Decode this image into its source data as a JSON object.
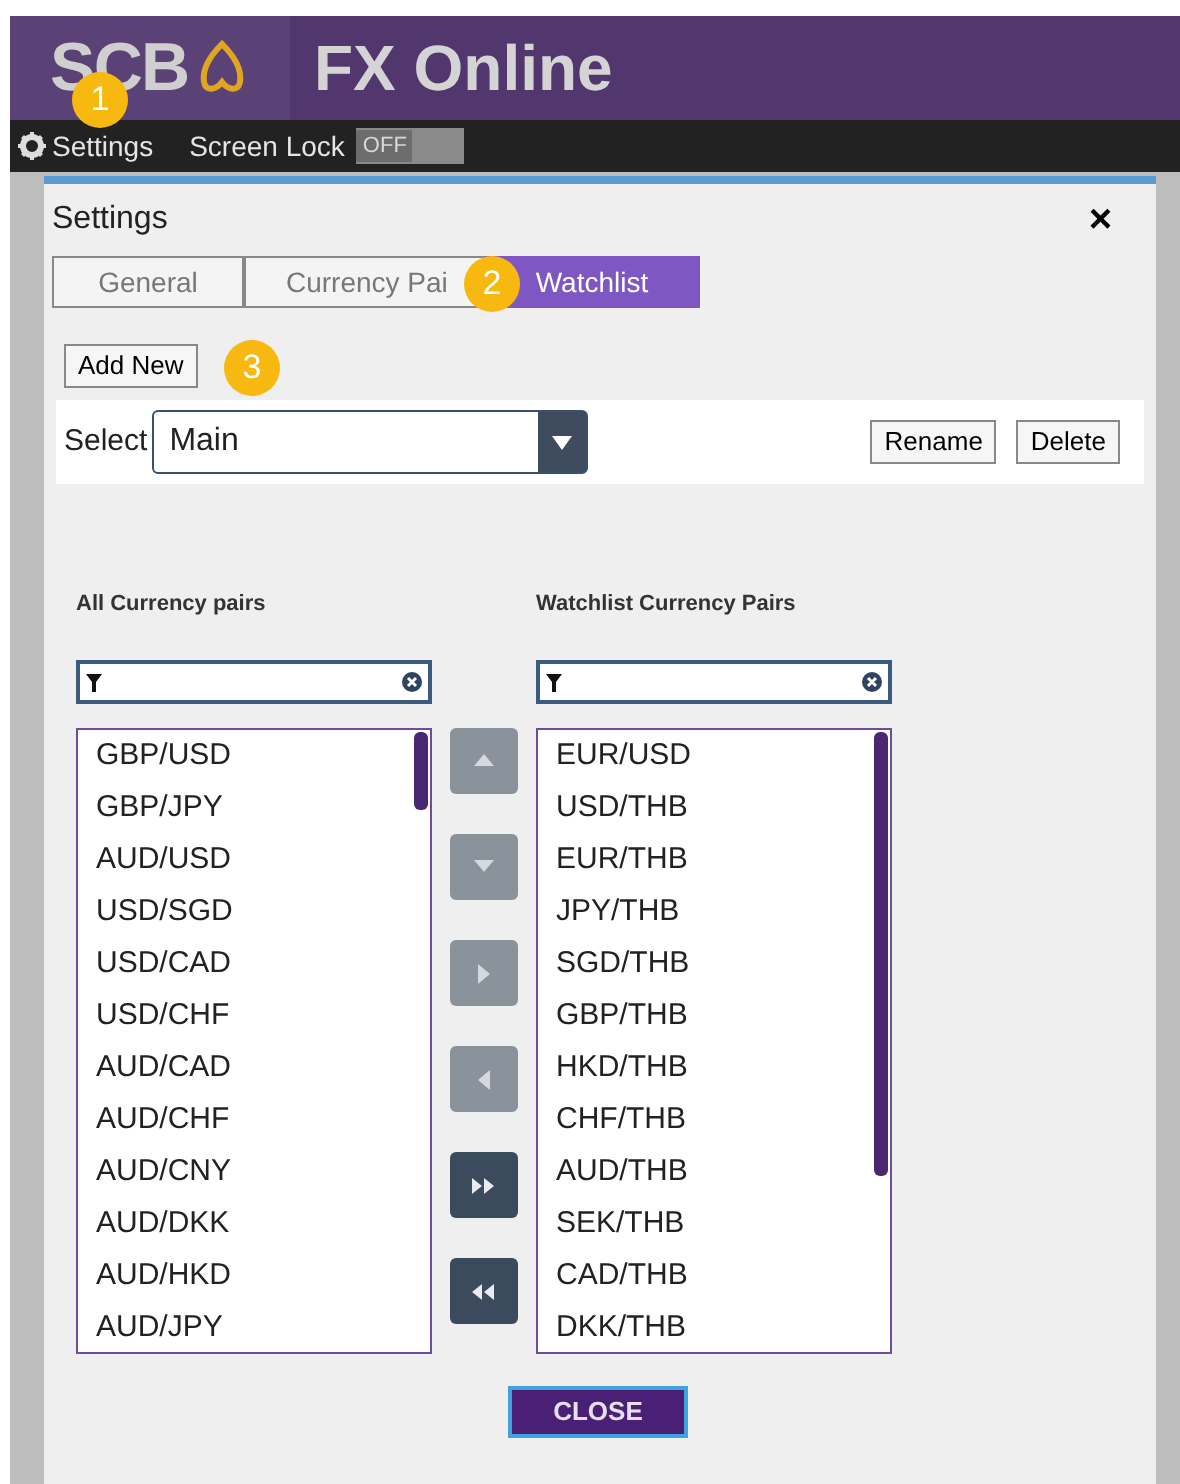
{
  "header": {
    "logo": "SCB",
    "title": "FX Online"
  },
  "menu_bar": {
    "settings": "Settings",
    "screen_lock": {
      "label": "Screen Lock",
      "state_text": "OFF",
      "on": false
    }
  },
  "callouts": [
    "1",
    "2",
    "3"
  ],
  "dialog": {
    "title": "Settings",
    "close": "×",
    "tabs": [
      {
        "label": "General",
        "selected": false
      },
      {
        "label": "Currency Pai",
        "selected": false
      },
      {
        "label": "Watchlist",
        "selected": true
      }
    ],
    "add_new": "Add New",
    "select": {
      "label": "Select",
      "value": "Main"
    },
    "rename": "Rename",
    "delete": "Delete",
    "all_pairs": {
      "heading": "All Currency pairs",
      "items": [
        "GBP/USD",
        "GBP/JPY",
        "AUD/USD",
        "USD/SGD",
        "USD/CAD",
        "USD/CHF",
        "AUD/CAD",
        "AUD/CHF",
        "AUD/CNY",
        "AUD/DKK",
        "AUD/HKD",
        "AUD/JPY"
      ]
    },
    "move_buttons": [
      {
        "kind": "up",
        "disabled": true
      },
      {
        "kind": "down",
        "disabled": true
      },
      {
        "kind": "right",
        "disabled": true
      },
      {
        "kind": "left",
        "disabled": true
      },
      {
        "kind": "all-right",
        "disabled": false
      },
      {
        "kind": "all-left",
        "disabled": false
      }
    ],
    "watchlist_pairs": {
      "heading": "Watchlist Currency Pairs",
      "items": [
        "EUR/USD",
        "USD/THB",
        "EUR/THB",
        "JPY/THB",
        "SGD/THB",
        "GBP/THB",
        "HKD/THB",
        "CHF/THB",
        "AUD/THB",
        "SEK/THB",
        "CAD/THB",
        "DKK/THB"
      ]
    },
    "close_button": "CLOSE"
  }
}
